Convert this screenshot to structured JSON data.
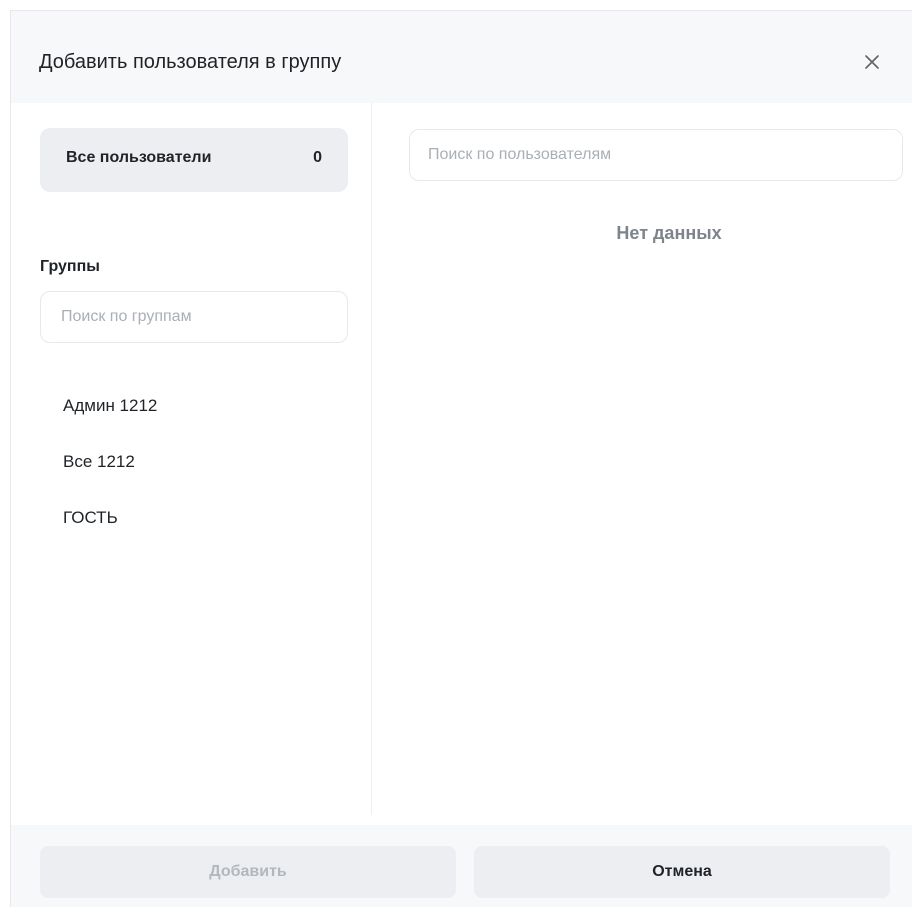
{
  "dialog": {
    "title": "Добавить пользователя в группу",
    "close_icon": "close-icon"
  },
  "sidebar": {
    "all_users": {
      "label": "Все пользователи",
      "count": "0"
    },
    "groups_heading": "Группы",
    "group_search_placeholder": "Поиск по группам",
    "groups": [
      {
        "label": "Админ 1212"
      },
      {
        "label": "Все 1212"
      },
      {
        "label": "ГОСТЬ"
      }
    ]
  },
  "main": {
    "user_search_placeholder": "Поиск по пользователям",
    "empty_text": "Нет данных"
  },
  "footer": {
    "add_label": "Добавить",
    "add_disabled": true,
    "cancel_label": "Отмена"
  },
  "colors": {
    "header_bg": "#f7f8f9",
    "selected_bg": "#eceef1",
    "muted_text": "#7d848c",
    "disabled_text": "#b3b8bf"
  }
}
